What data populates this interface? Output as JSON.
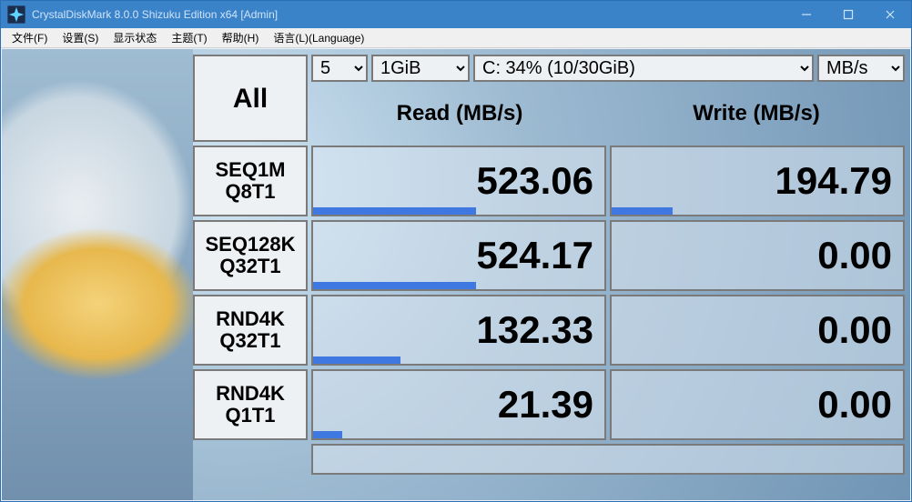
{
  "window": {
    "title": "CrystalDiskMark 8.0.0 Shizuku Edition x64 [Admin]"
  },
  "menu": {
    "file": "文件(F)",
    "settings": "设置(S)",
    "display": "显示状态",
    "theme": "主题(T)",
    "help": "帮助(H)",
    "language": "语言(L)(Language)"
  },
  "controls": {
    "all": "All",
    "count": "5",
    "size": "1GiB",
    "drive": "C: 34% (10/30GiB)",
    "unit": "MB/s"
  },
  "headers": {
    "read": "Read (MB/s)",
    "write": "Write (MB/s)"
  },
  "rows": [
    {
      "label1": "SEQ1M",
      "label2": "Q8T1",
      "read": "523.06",
      "write": "194.79",
      "read_pct": 56,
      "write_pct": 21
    },
    {
      "label1": "SEQ128K",
      "label2": "Q32T1",
      "read": "524.17",
      "write": "0.00",
      "read_pct": 56,
      "write_pct": 0
    },
    {
      "label1": "RND4K",
      "label2": "Q32T1",
      "read": "132.33",
      "write": "0.00",
      "read_pct": 30,
      "write_pct": 0
    },
    {
      "label1": "RND4K",
      "label2": "Q1T1",
      "read": "21.39",
      "write": "0.00",
      "read_pct": 10,
      "write_pct": 0
    }
  ]
}
